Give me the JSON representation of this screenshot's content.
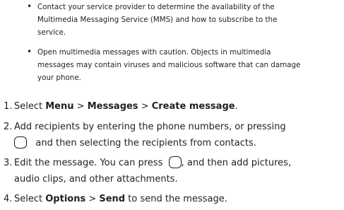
{
  "bullets": [
    {
      "lines": [
        "Contact your service provider to determine the availability of the",
        "Multimedia Messaging Service (MMS) and how to subscribe to the",
        "service."
      ]
    },
    {
      "lines": [
        "Open multimedia messages with caution. Objects in multimedia",
        "messages may contain viruses and malicious software that can damage",
        "your phone."
      ]
    }
  ],
  "steps": {
    "s1": {
      "num": "1.",
      "pre": "Select ",
      "b1": "Menu",
      "sep1": " > ",
      "b2": "Messages",
      "sep2": " > ",
      "b3": "Create message",
      "post": "."
    },
    "s2": {
      "num": "2.",
      "line1": "Add recipients by entering the phone numbers, or pressing",
      "line2": "and then selecting the recipients from contacts."
    },
    "s3": {
      "num": "3.",
      "pre": "Edit the message. You can press",
      "post": ", and then add pictures,",
      "line2": "audio clips, and other attachments."
    },
    "s4": {
      "num": "4.",
      "pre": "Select ",
      "b1": "Options",
      "sep1": " > ",
      "b2": "Send",
      "post": " to send the message."
    }
  }
}
